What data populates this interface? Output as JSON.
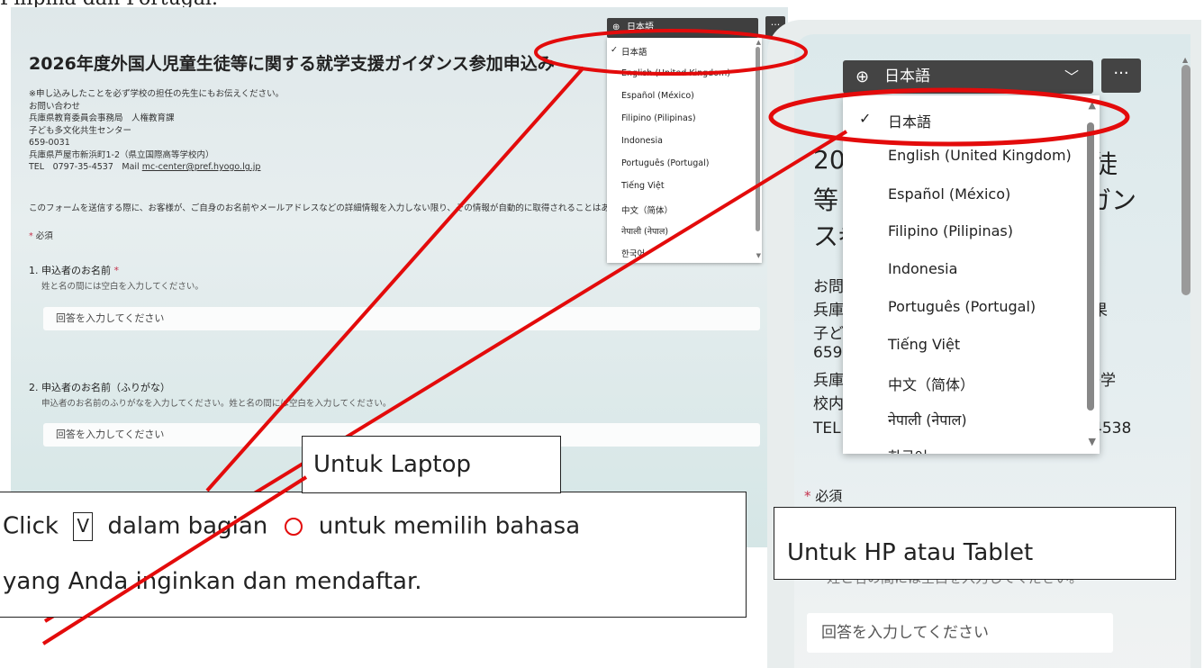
{
  "top_line": "Filipina dan Portugal.",
  "laptop": {
    "title": "2026年度外国人児童生徒等に関する就学支援ガイダンス参加申込み",
    "info_lines": [
      "※申し込みしたことを必ず学校の担任の先生にもお伝えください。",
      "お問い合わせ",
      "兵庫県教育委員会事務局　人権教育課",
      "子ども多文化共生センター",
      "659-0031",
      "兵庫県芦屋市新浜町1-2（県立国際高等学校内）"
    ],
    "tel_line": "TEL　0797-35-4537　Mail",
    "email": "mc-center@pref.hyogo.lg.jp",
    "privacy": "このフォームを送信する際に、お客様が、ご自身のお名前やメールアドレスなどの詳細情報を入力しない限り、その情報が自動的に取得されることはありません。",
    "required_star": "*",
    "required_text": "必須",
    "q1_label": "1. 申込者のお名前",
    "q1_star": "*",
    "q1_hint": "姓と名の間には空白を入力してください。",
    "q2_label": "2. 申込者のお名前（ふりがな）",
    "q2_hint": "申込者のお名前のふりがなを入力してください。姓と名の間には空白を入力してください。",
    "answer_placeholder": "回答を入力してください",
    "lang_selected": "日本語",
    "more": "···"
  },
  "languages": [
    "日本語",
    "English (United Kingdom)",
    "Español (México)",
    "Filipino (Pilipinas)",
    "Indonesia",
    "Português (Portugal)",
    "Tiếng Việt",
    "中文（简体）",
    "नेपाली (नेपाल)",
    "한국어"
  ],
  "phone": {
    "lang_selected": "日本語",
    "more": "···",
    "title_frags": [
      "20",
      "徒",
      "等",
      "ガン",
      "ス参"
    ],
    "info_frags": [
      "お問",
      "兵庫",
      "果",
      "子ど",
      "659",
      "兵庫",
      "等学",
      "校内",
      "TEL",
      "4538"
    ],
    "required_star": "*",
    "required_text": "必須",
    "hint_partial": "姓と名の間には空白を入力してください。",
    "answer_placeholder": "回答を入力してください"
  },
  "callouts": {
    "laptop_tag": "Untuk Laptop",
    "instr_click": "Click",
    "instr_v": "V",
    "instr_rest": "dalam bagian",
    "instr_rest2": "untuk memilih bahasa",
    "instr_line2": "yang Anda inginkan dan mendaftar.",
    "hp_tag": "Untuk HP atau Tablet"
  },
  "colors": {
    "annotation": "#e30b0b",
    "dark_bar": "#3f3f3f",
    "required": "#c4314b"
  }
}
